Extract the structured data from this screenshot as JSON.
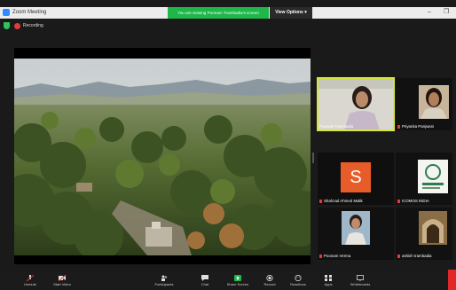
{
  "window": {
    "title": "Zoom Meeting",
    "banner": "You are viewing Poonam Trambadia's screen",
    "view_options": "View Options ▾",
    "minimize": "–",
    "restore": "❐"
  },
  "status": {
    "recording": "Recording"
  },
  "participants": [
    {
      "name": "Poonam Trambadia",
      "active": true
    },
    {
      "name": "Priyanka Panjwani"
    },
    {
      "name": "Shahzad Ahmed Malik",
      "avatar_letter": "S"
    },
    {
      "name": "ICOMOS INDIA"
    },
    {
      "name": "Poonam Verma"
    },
    {
      "name": "ashish trambadia"
    }
  ],
  "toolbar": [
    {
      "label": "Unmute",
      "icon": "mic-off-icon"
    },
    {
      "label": "Start Video",
      "icon": "video-off-icon"
    },
    {
      "label": "Participants",
      "icon": "participants-icon",
      "count": "4"
    },
    {
      "label": "Chat",
      "icon": "chat-icon"
    },
    {
      "label": "Share Screen",
      "icon": "share-screen-icon"
    },
    {
      "label": "Record",
      "icon": "record-icon"
    },
    {
      "label": "Reactions",
      "icon": "reactions-icon"
    },
    {
      "label": "Apps",
      "icon": "apps-icon"
    },
    {
      "label": "Whiteboards",
      "icon": "whiteboard-icon"
    }
  ],
  "colors": {
    "share_green": "#1fb64a",
    "active_outline": "#d6e838",
    "end_red": "#e02828",
    "avatar_orange": "#e85c2a"
  }
}
